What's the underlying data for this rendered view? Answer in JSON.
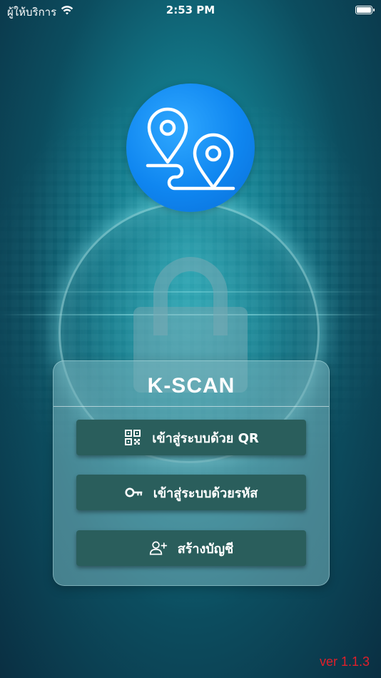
{
  "status_bar": {
    "carrier": "ผู้ให้บริการ",
    "time": "2:53 PM"
  },
  "app": {
    "title": "K-SCAN",
    "logo_icon": "map-route-pins-icon",
    "version": "ver 1.1.3"
  },
  "buttons": [
    {
      "label": "เข้าสู่ระบบด้วย QR",
      "icon": "qr-code-icon"
    },
    {
      "label": "เข้าสู่ระบบด้วยรหัส",
      "icon": "key-icon"
    },
    {
      "label": "สร้างบัญชี",
      "icon": "add-user-icon"
    }
  ],
  "colors": {
    "logo_blue": "#0f86f0",
    "button_bg": "#2a5e5c",
    "version_red": "#e11f2a"
  }
}
